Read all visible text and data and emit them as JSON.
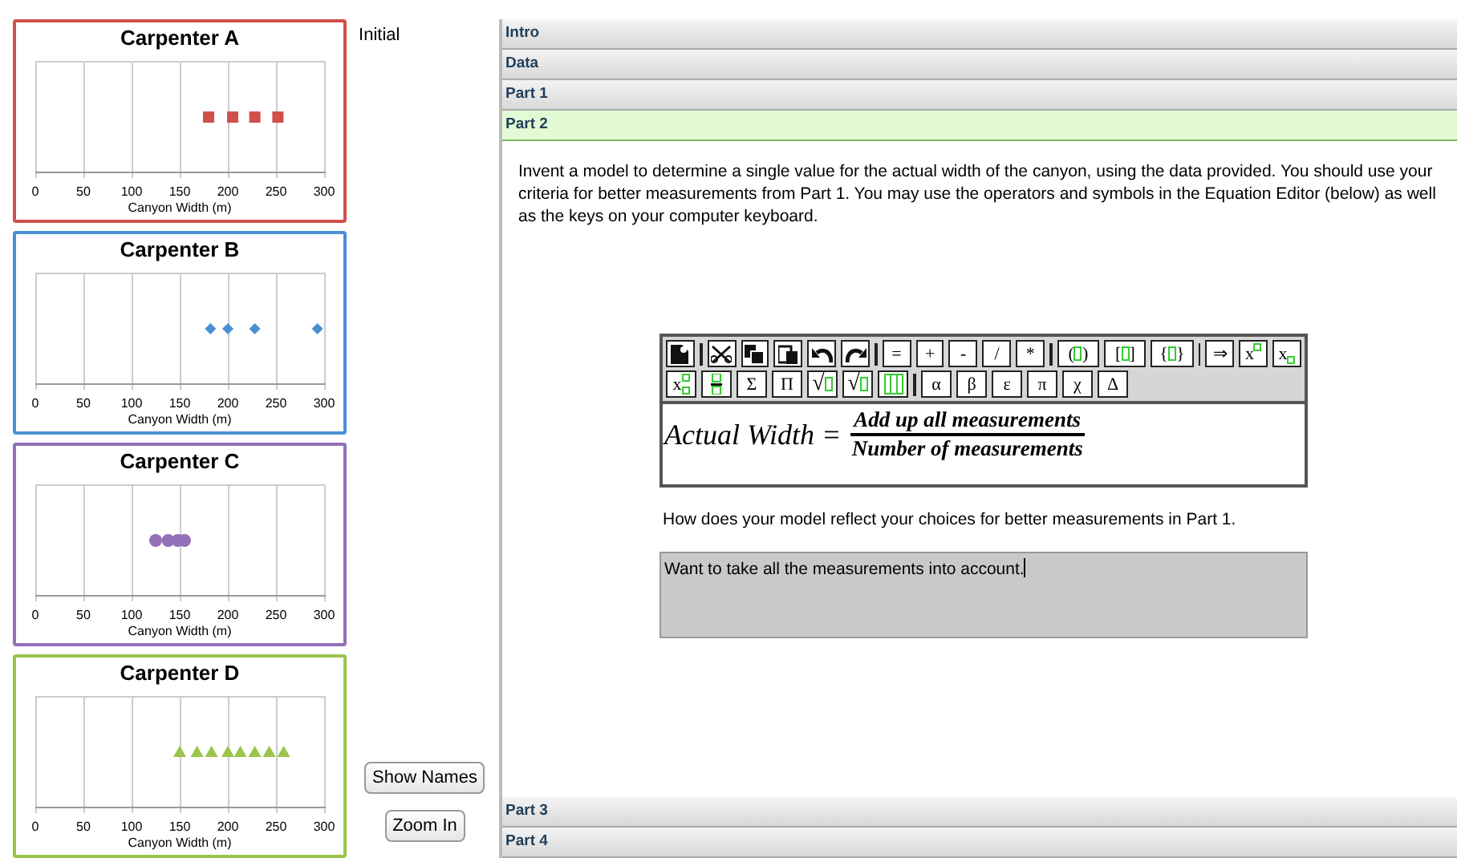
{
  "carpenters": [
    {
      "title": "Carpenter A",
      "color": "#d0504a",
      "kind": "square",
      "tick_labels": [
        "0",
        "50",
        "100",
        "150",
        "200",
        "250",
        "300"
      ],
      "xlabel": "Canyon Width (m)"
    },
    {
      "title": "Carpenter B",
      "color": "#4a8fd4",
      "kind": "diamond",
      "tick_labels": [
        "0",
        "50",
        "100",
        "150",
        "200",
        "250",
        "300"
      ],
      "xlabel": "Canyon Width (m)"
    },
    {
      "title": "Carpenter C",
      "color": "#9370b8",
      "kind": "circle",
      "tick_labels": [
        "0",
        "50",
        "100",
        "150",
        "200",
        "250",
        "300"
      ],
      "xlabel": "Canyon Width (m)"
    },
    {
      "title": "Carpenter D",
      "color": "#9cc44a",
      "kind": "triangle",
      "tick_labels": [
        "0",
        "50",
        "100",
        "150",
        "200",
        "250",
        "300"
      ],
      "xlabel": "Canyon Width (m)"
    }
  ],
  "initial_label": "Initial",
  "buttons": [
    "Show Names",
    "Zoom In"
  ],
  "sections": [
    {
      "label": "Intro",
      "selected": false
    },
    {
      "label": "Data",
      "selected": false
    },
    {
      "label": "Part 1",
      "selected": false
    },
    {
      "label": "Part 2",
      "selected": true
    },
    {
      "label": "Part 3",
      "selected": false
    },
    {
      "label": "Part 4",
      "selected": false
    }
  ],
  "content": {
    "instructions": "Invent a model to determine a single value for the actual width of the canyon, using the data provided. You should use your criteria for better measurements from Part 1. You may use the operators and symbols in the Equation Editor (below) as well as the keys on your computer keyboard.",
    "toolbar_rows": [
      [
        {
          "kind": "icon"
        },
        {
          "kind": "separator"
        },
        {
          "kind": "icon"
        },
        {
          "kind": "icon"
        },
        {
          "kind": "icon"
        },
        {
          "kind": "icon"
        },
        {
          "kind": "icon"
        },
        {
          "kind": "separator"
        },
        {
          "kind": "symbol",
          "label": "="
        },
        {
          "kind": "symbol",
          "label": "+"
        },
        {
          "kind": "symbol",
          "label": "-"
        },
        {
          "kind": "symbol",
          "label": "/"
        },
        {
          "kind": "symbol",
          "label": "*"
        },
        {
          "kind": "separator"
        },
        {
          "kind": "wrap",
          "open": "(",
          "close": ")"
        },
        {
          "kind": "wrap",
          "open": "[",
          "close": "]"
        },
        {
          "kind": "wrap",
          "open": "{",
          "close": "}"
        },
        {
          "kind": "separator"
        },
        {
          "kind": "symbol",
          "label": "⇒"
        },
        {
          "kind": "superscript",
          "label": "x"
        },
        {
          "kind": "subscript",
          "label": "x"
        }
      ],
      [
        {
          "kind": "subsup",
          "label": "x"
        },
        {
          "kind": "icon"
        },
        {
          "kind": "symbol",
          "label": "Σ"
        },
        {
          "kind": "symbol",
          "label": "Π"
        },
        {
          "kind": "root",
          "label": "√"
        },
        {
          "kind": "root",
          "label": "√"
        },
        {
          "kind": "icon"
        },
        {
          "kind": "separator"
        },
        {
          "kind": "symbol",
          "label": "α"
        },
        {
          "kind": "symbol",
          "label": "β"
        },
        {
          "kind": "symbol",
          "label": "ε"
        },
        {
          "kind": "symbol",
          "label": "π"
        },
        {
          "kind": "symbol",
          "label": "χ"
        },
        {
          "kind": "symbol",
          "label": "Δ"
        }
      ]
    ],
    "equation": {
      "lhs": "Actual Width =",
      "numerator": "Add up all measurements",
      "denominator": "Number of measurements"
    },
    "question": "How does your model reflect your choices for better measurements in Part 1.",
    "answer": "Want to take all the measurements into account."
  }
}
